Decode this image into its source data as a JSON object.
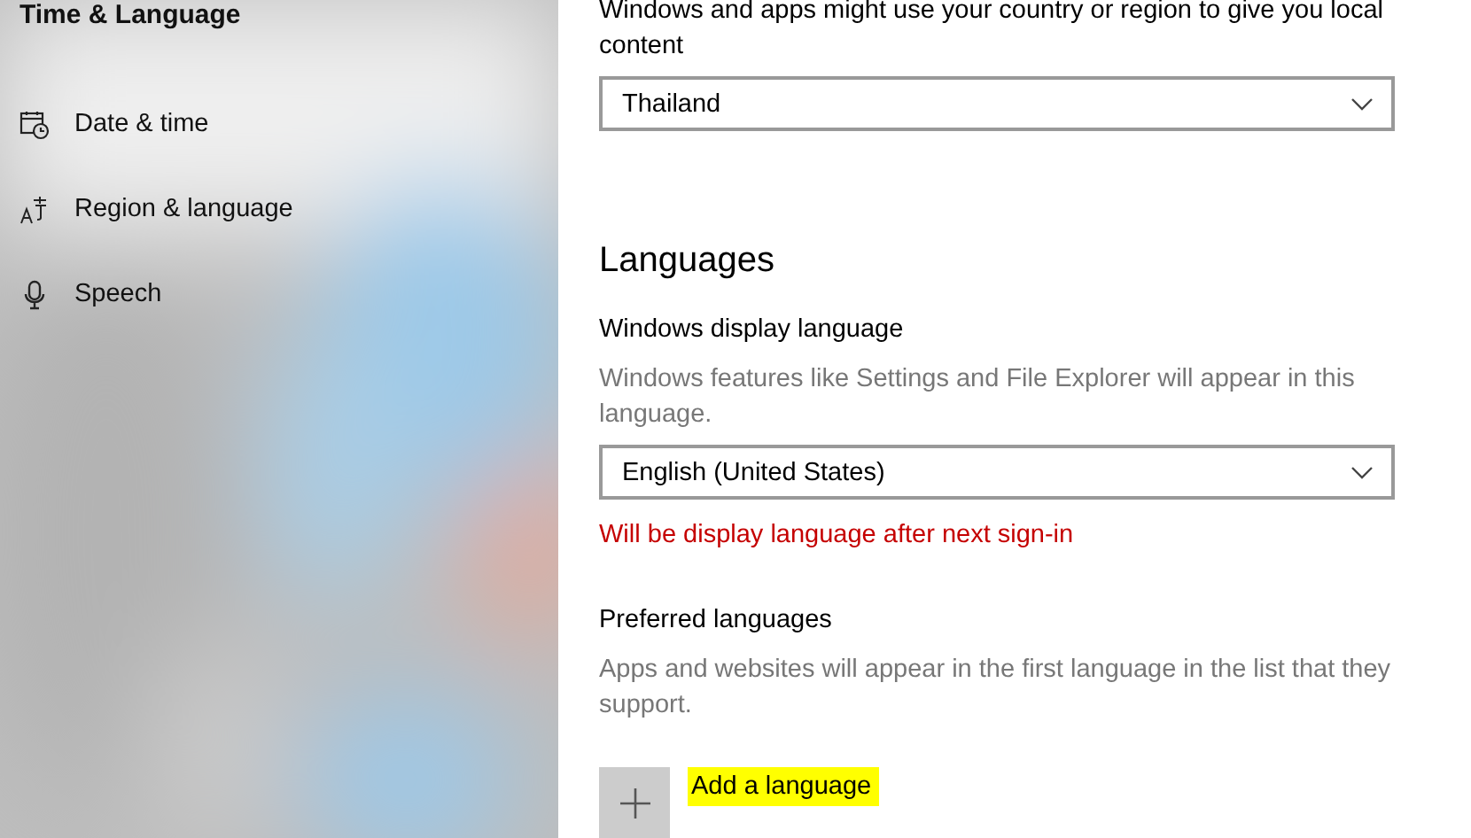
{
  "sidebar": {
    "title": "Time & Language",
    "items": [
      {
        "kind": "date",
        "label": "Date & time",
        "selected": false
      },
      {
        "kind": "region",
        "label": "Region & language",
        "selected": false
      },
      {
        "kind": "speech",
        "label": "Speech",
        "selected": false
      }
    ]
  },
  "region": {
    "description": "Windows and apps might use your country or region to give you local content",
    "country": "Thailand"
  },
  "languages": {
    "heading": "Languages",
    "display_label": "Windows display language",
    "display_description": "Windows features like Settings and File Explorer will appear in this language.",
    "display_value": "English (United States)",
    "warning": "Will be display language after next sign-in",
    "preferred_label": "Preferred languages",
    "preferred_description": "Apps and websites will appear in the first language in the list that they support.",
    "add_label": "Add a language",
    "add_highlighted": true
  }
}
